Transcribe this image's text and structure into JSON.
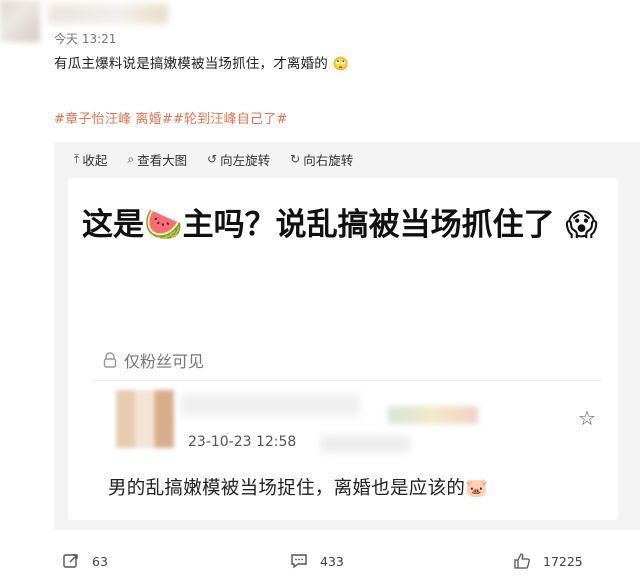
{
  "post": {
    "time": "今天 13:21",
    "text": "有瓜主爆料说是搞嫩模被当场抓住，才离婚的",
    "text_emoji": "🙄",
    "tags": "#章子怡汪峰 离婚##轮到汪峰自己了#"
  },
  "toolbar": {
    "collapse": "收起",
    "view_full": "查看大图",
    "rotate_left": "向左旋转",
    "rotate_right": "向右旋转"
  },
  "image_content": {
    "title_part1": "这是",
    "title_emoji1": "🍉",
    "title_part2": "主吗？说乱搞被当场抓住了",
    "title_emoji2": "😱",
    "visibility": "仅粉丝可见",
    "comment_date": "23-10-23 12:58",
    "comment_text": "男的乱搞嫩模被当场捉住，离婚也是应该的",
    "comment_emoji": "🐷"
  },
  "footer": {
    "reposts": "63",
    "comments": "433",
    "likes": "17225"
  },
  "colors": {
    "tag": "#eb7350",
    "panel_bg": "#f3f3f3"
  }
}
